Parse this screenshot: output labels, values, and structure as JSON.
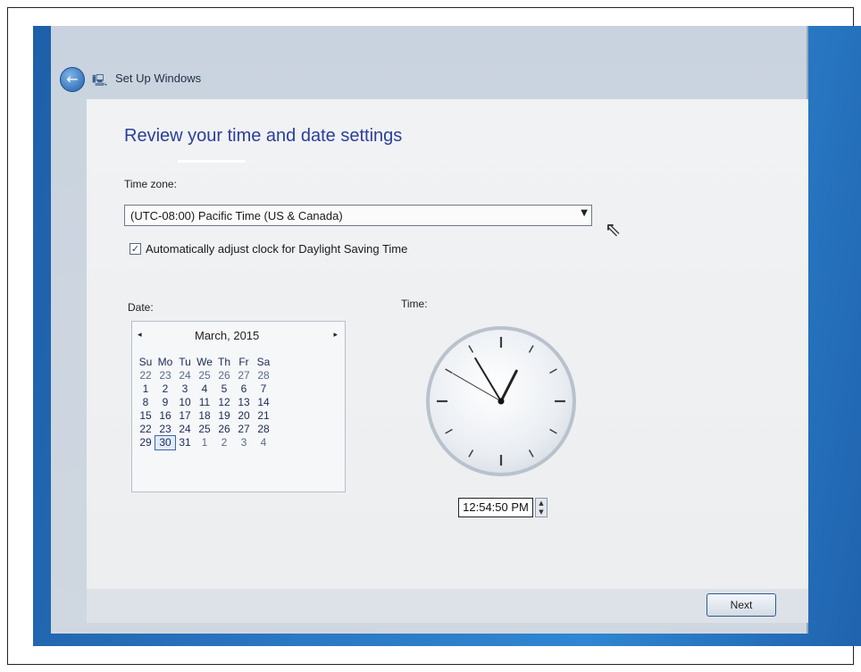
{
  "window": {
    "title": "Set Up Windows"
  },
  "page": {
    "heading": "Review your time and date settings",
    "time_zone_label": "Time zone:",
    "time_zone_value": "(UTC-08:00) Pacific Time (US & Canada)",
    "dst_label": "Automatically adjust clock for Daylight Saving Time",
    "dst_checked": true,
    "date_label": "Date:",
    "time_label": "Time:"
  },
  "calendar": {
    "month_label": "March, 2015",
    "prev": "◂",
    "next": "▸",
    "weekdays": [
      "Su",
      "Mo",
      "Tu",
      "We",
      "Th",
      "Fr",
      "Sa"
    ],
    "weeks": [
      [
        "22",
        "23",
        "24",
        "25",
        "26",
        "27",
        "28"
      ],
      [
        "1",
        "2",
        "3",
        "4",
        "5",
        "6",
        "7"
      ],
      [
        "8",
        "9",
        "10",
        "11",
        "12",
        "13",
        "14"
      ],
      [
        "15",
        "16",
        "17",
        "18",
        "19",
        "20",
        "21"
      ],
      [
        "22",
        "23",
        "24",
        "25",
        "26",
        "27",
        "28"
      ],
      [
        "29",
        "30",
        "31",
        "1",
        "2",
        "3",
        "4"
      ]
    ],
    "selected": "30"
  },
  "clock": {
    "hour": 12,
    "minute": 54,
    "second": 50
  },
  "time_value": "12:54:50 PM",
  "footer": {
    "next_label": "Next"
  },
  "colors": {
    "heading": "#2a3f9a",
    "desktop": "#2b78c4"
  },
  "icons": {
    "back": "back-arrow-icon",
    "app": "setup-icon"
  }
}
